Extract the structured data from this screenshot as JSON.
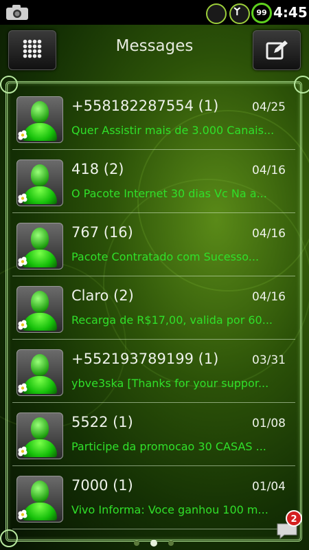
{
  "status_bar": {
    "battery_level": "99",
    "time": "4:45",
    "icons": [
      "camera-icon",
      "weather-icon",
      "signal-icon",
      "battery-icon"
    ]
  },
  "header": {
    "title": "Messages",
    "left_button_icon": "grid-icon",
    "right_button_icon": "compose-icon"
  },
  "conversations": [
    {
      "sender": "+558182287554 (1)",
      "date": "04/25",
      "preview": "Quer Assistir mais de 3.000 Canais..."
    },
    {
      "sender": "418 (2)",
      "date": "04/16",
      "preview": "O Pacote Internet 30 dias Vc Na a..."
    },
    {
      "sender": "767 (16)",
      "date": "04/16",
      "preview": "Pacote Contratado com Sucesso..."
    },
    {
      "sender": "Claro (2)",
      "date": "04/16",
      "preview": "Recarga de R$17,00, valida por 60..."
    },
    {
      "sender": "+552193789199 (1)",
      "date": "03/31",
      "preview": "ybve3ska [Thanks for your suppor..."
    },
    {
      "sender": "5522 (1)",
      "date": "01/08",
      "preview": "Participe da promocao 30 CASAS ..."
    },
    {
      "sender": "7000 (1)",
      "date": "01/04",
      "preview": "Vivo Informa: Voce ganhou 100 m..."
    }
  ],
  "notification_badge": "2",
  "colors": {
    "preview_text": "#30e02a",
    "frame": "#a6d98a",
    "badge": "#d42020",
    "battery_ring": "#5fd11e"
  }
}
